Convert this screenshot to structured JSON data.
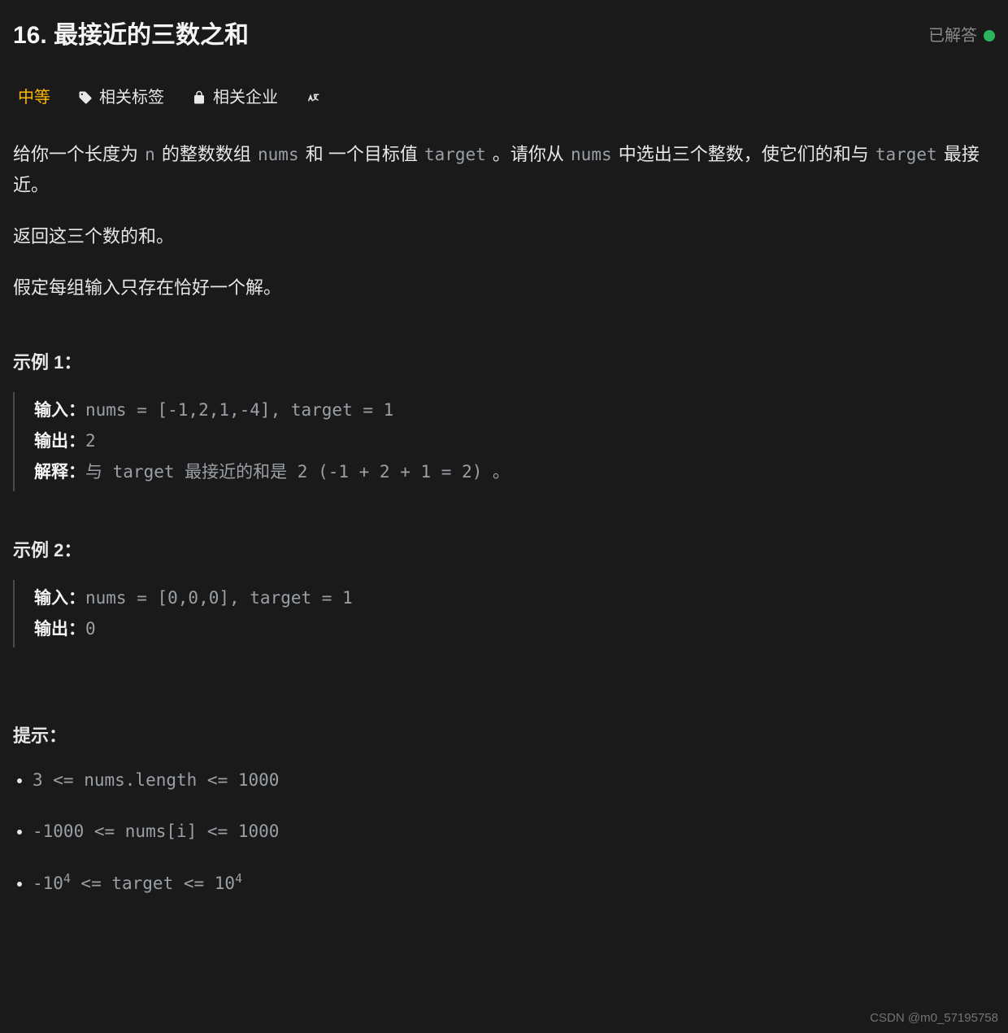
{
  "header": {
    "title": "16. 最接近的三数之和",
    "status_label": "已解答"
  },
  "meta": {
    "difficulty": "中等",
    "tags_label": "相关标签",
    "companies_label": "相关企业"
  },
  "description": {
    "p1_a": "给你一个长度为 ",
    "code_n": "n",
    "p1_b": " 的整数数组 ",
    "code_nums": "nums",
    "p1_c": " 和 一个目标值 ",
    "code_target": "target",
    "p1_d": " 。请你从 ",
    "code_nums2": "nums",
    "p1_e": " 中选出三个整数，使它们的和与 ",
    "code_target2": "target",
    "p1_f": " 最接近。",
    "p2": "返回这三个数的和。",
    "p3": "假定每组输入只存在恰好一个解。"
  },
  "labels": {
    "input": "输入：",
    "output": "输出：",
    "explain": "解释："
  },
  "examples": {
    "h1": "示例 1：",
    "e1_input": "nums = [-1,2,1,-4], target = 1",
    "e1_output": "2",
    "e1_explain": "与 target 最接近的和是 2 (-1 + 2 + 1 = 2) 。",
    "h2": "示例 2：",
    "e2_input": "nums = [0,0,0], target = 1",
    "e2_output": "0"
  },
  "hints": {
    "header": "提示：",
    "c1": "3 <= nums.length <= 1000",
    "c2": "-1000 <= nums[i] <= 1000",
    "c3a": "-10",
    "c3sup1": "4",
    "c3b": " <= target <= 10",
    "c3sup2": "4"
  },
  "watermark": "CSDN @m0_57195758"
}
